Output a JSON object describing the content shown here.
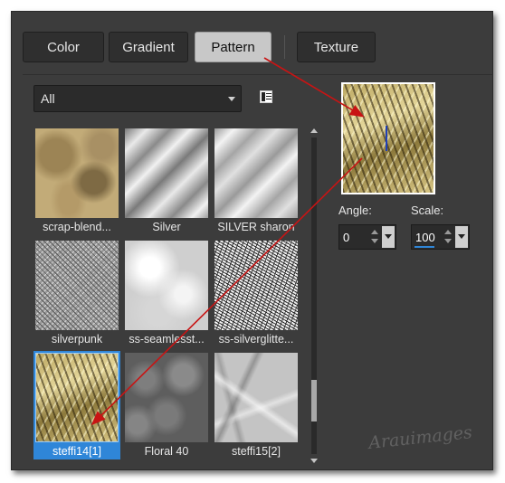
{
  "tabs": [
    {
      "label": "Color",
      "active": false
    },
    {
      "label": "Gradient",
      "active": false
    },
    {
      "label": "Pattern",
      "active": true
    },
    {
      "label": "Texture",
      "active": false
    }
  ],
  "filter": {
    "selected": "All"
  },
  "patterns": [
    {
      "label": "scrap-blend...",
      "texture": "camo",
      "selected": false
    },
    {
      "label": "Silver",
      "texture": "silver",
      "selected": false
    },
    {
      "label": "SILVER sharon",
      "texture": "silver2",
      "selected": false
    },
    {
      "label": "silverpunk",
      "texture": "punk",
      "selected": false
    },
    {
      "label": "ss-seamlesst...",
      "texture": "cloud",
      "selected": false
    },
    {
      "label": "ss-silverglitte...",
      "texture": "glitter",
      "selected": false
    },
    {
      "label": "steffi14[1]",
      "texture": "gold",
      "selected": true
    },
    {
      "label": "Floral 40",
      "texture": "floral",
      "selected": false
    },
    {
      "label": "steffi15[2]",
      "texture": "crumple",
      "selected": false
    }
  ],
  "angle": {
    "label": "Angle:",
    "value": "0"
  },
  "scale": {
    "label": "Scale:",
    "value": "100"
  },
  "colors": {
    "selection": "#2f86d8",
    "annotation_arrow": "#c81414"
  }
}
